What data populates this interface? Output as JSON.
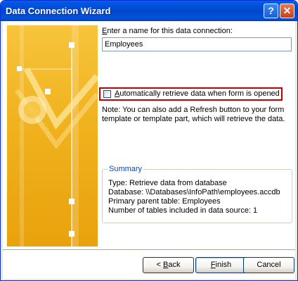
{
  "window": {
    "title": "Data Connection Wizard",
    "help_glyph": "?",
    "close_glyph": "✕"
  },
  "form": {
    "name_prompt_prefix": "E",
    "name_prompt_rest": "nter a name for this data connection:",
    "name_value": "Employees",
    "auto_retrieve_prefix": "A",
    "auto_retrieve_rest": "utomatically retrieve data when form is opened",
    "auto_retrieve_checked": false,
    "note_line1": "Note: You can also add a Refresh button to your form",
    "note_line2": "template or template part, which will retrieve the data."
  },
  "summary": {
    "title": "Summary",
    "lines": [
      "Type: Retrieve data from database",
      "Database: \\\\Databases\\InfoPath\\employees.accdb",
      "Primary parent table: Employees",
      "Number of tables included in data source: 1"
    ]
  },
  "buttons": {
    "back_prefix": "< ",
    "back_accel": "B",
    "back_rest": "ack",
    "next_accel": "F",
    "next_rest": "inish",
    "cancel": "Cancel"
  },
  "colors": {
    "titlebar": "#0054e3",
    "art_gold": "#f0b21e",
    "highlight_border": "#c00000",
    "summary_title": "#0046d5"
  }
}
